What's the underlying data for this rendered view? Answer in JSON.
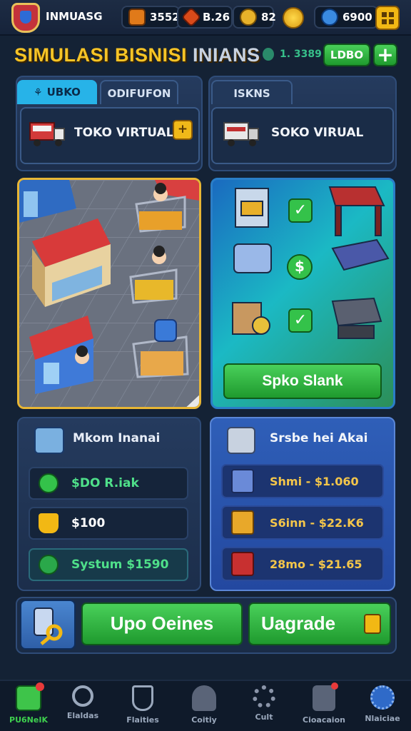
{
  "topbar": {
    "player_name": "INMUASG",
    "resource_1": "3552",
    "resource_2": "B.26",
    "resource_3": "82",
    "currency": "6900"
  },
  "header": {
    "title_part1": "SIMULASI BISNISI",
    "title_part2": "INIANS",
    "xp_value": "1. 3389",
    "lobo_button": "LDBO",
    "plus_button": "+"
  },
  "left_store": {
    "tabs": [
      {
        "label": "UBKO",
        "active": true
      },
      {
        "label": "ODIFUFON",
        "active": false
      }
    ],
    "card_label": "TOKO VIRTUAL",
    "card_action": "+"
  },
  "right_store": {
    "tabs": [
      {
        "label": "ISKNS",
        "active": true
      }
    ],
    "card_label": "SOKO VIRUAL"
  },
  "equipment": {
    "button_label": "Spko Slank",
    "check_1": "✓",
    "dollar_badge": "$",
    "check_2": "✓"
  },
  "left_panel": {
    "title": "Mkom Inanai",
    "rows": [
      {
        "text": "$DO R.iak",
        "color": "#4fe08a",
        "icon": "check-circle"
      },
      {
        "text": "$100",
        "color": "#ffffff",
        "icon": "hand-coin"
      },
      {
        "text": "Systum $1590",
        "color": "#4fe08a",
        "icon": "dollar-circle"
      }
    ]
  },
  "right_panel": {
    "title": "Srsbe hei Akai",
    "rows": [
      {
        "text": "Shmi  - $1.060",
        "icon": "shelf-box"
      },
      {
        "text": "S6inn  - $22.K6",
        "icon": "crate-box"
      },
      {
        "text": "28mo  - $21.65",
        "icon": "red-bag"
      }
    ]
  },
  "actions": {
    "primary": "Upo Oeines",
    "upgrade": "Uagrade"
  },
  "bottom_nav": [
    {
      "label": "PU6NeIK",
      "icon": "home-icon",
      "active": true
    },
    {
      "label": "Elaldas",
      "icon": "search-icon",
      "active": false
    },
    {
      "label": "Flaities",
      "icon": "shield-check-icon",
      "active": false
    },
    {
      "label": "Coitiy",
      "icon": "helmet-icon",
      "active": false
    },
    {
      "label": "Cult",
      "icon": "gear-icon",
      "active": false
    },
    {
      "label": "Cioacaion",
      "icon": "shop-icon",
      "active": false
    },
    {
      "label": "Nlaiciae",
      "icon": "settings-icon",
      "active": false
    }
  ],
  "colors": {
    "gold": "#f6c426",
    "green_button": "#2fb640",
    "panel_blue": "#253b5e",
    "accent_cyan": "#27b3e8"
  }
}
